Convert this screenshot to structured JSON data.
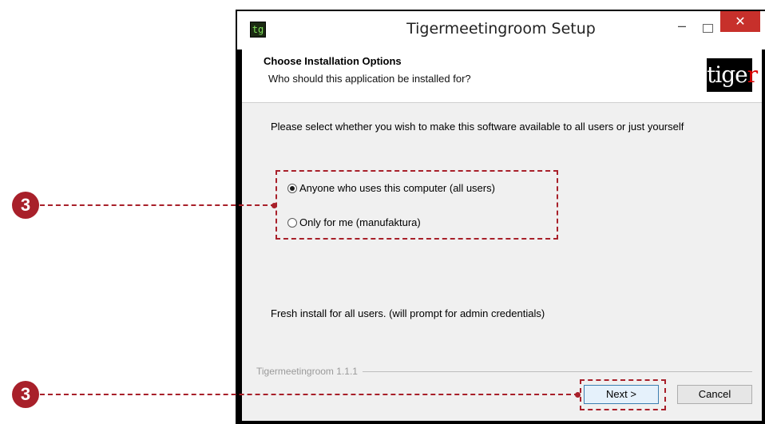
{
  "window": {
    "title": "Tigermeetingroom Setup",
    "app_icon_glyph": "tg",
    "minimize_glyph": "–",
    "close_glyph": "✕"
  },
  "header": {
    "title": "Choose Installation Options",
    "subtitle": "Who should this application be installed for?",
    "logo_text_a": "tige",
    "logo_text_b": "r"
  },
  "body": {
    "prompt": "Please select whether you wish to make this software available to all users or just yourself",
    "options": [
      {
        "label": "Anyone who uses this computer (all users)",
        "checked": true
      },
      {
        "label": "Only for me (manufaktura)",
        "checked": false
      }
    ],
    "status": "Fresh install for all users. (will prompt for admin credentials)"
  },
  "footer": {
    "branding": "Tigermeetingroom 1.1.1",
    "next_label": "Next >",
    "cancel_label": "Cancel"
  },
  "annotations": {
    "callout_1": "3",
    "callout_2": "3"
  },
  "colors": {
    "annotation": "#a8202a",
    "close_button": "#c7302b",
    "next_border": "#3c7fb1"
  }
}
